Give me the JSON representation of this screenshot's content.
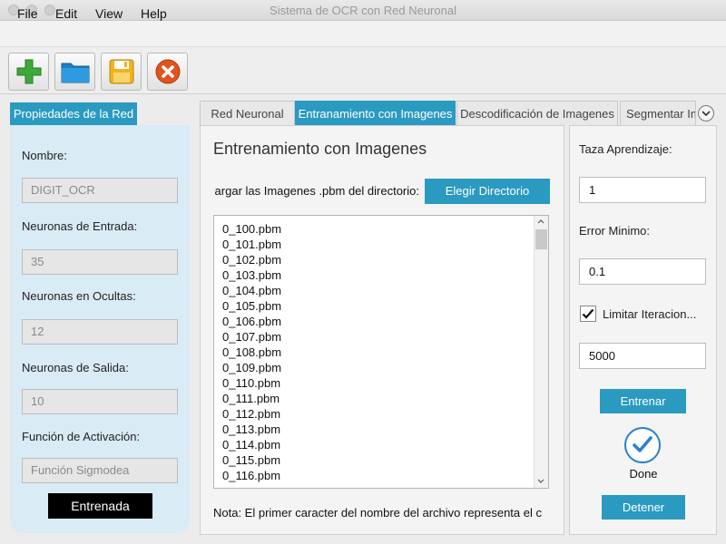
{
  "window": {
    "title": "Sistema de OCR con Red Neuronal"
  },
  "menu": {
    "items": [
      "File",
      "Edit",
      "View",
      "Help"
    ]
  },
  "toolbar": {
    "icons": [
      "add-icon",
      "folder-icon",
      "save-icon",
      "close-icon"
    ]
  },
  "left_panel": {
    "tab": "Propiedades de la Red",
    "fields": [
      {
        "label": "Nombre:",
        "value": "DIGIT_OCR"
      },
      {
        "label": "Neuronas de Entrada:",
        "value": "35"
      },
      {
        "label": "Neuronas en Ocultas:",
        "value": "12"
      },
      {
        "label": "Neuronas de Salida:",
        "value": "10"
      },
      {
        "label": "Función de Activación:",
        "value": "Función Sigmodea"
      }
    ],
    "status": "Entrenada"
  },
  "tabs": [
    "Red Neuronal",
    "Entranamiento con Imagenes",
    "Descodificación de Imagenes",
    "Segmentar Im"
  ],
  "center": {
    "title": "Entrenamiento con Imagenes",
    "dir_label": "argar las Imagenes .pbm del directorio:",
    "choose_button": "Elegir Directorio",
    "files": [
      "0_100.pbm",
      "0_101.pbm",
      "0_102.pbm",
      "0_103.pbm",
      "0_104.pbm",
      "0_105.pbm",
      "0_106.pbm",
      "0_107.pbm",
      "0_108.pbm",
      "0_109.pbm",
      "0_110.pbm",
      "0_111.pbm",
      "0_112.pbm",
      "0_113.pbm",
      "0_114.pbm",
      "0_115.pbm",
      "0_116.pbm"
    ],
    "note": "Nota: El primer caracter del nombre del archivo representa el c"
  },
  "right": {
    "learning_rate_label": "Taza Aprendizaje:",
    "learning_rate": "1",
    "min_error_label": "Error Minimo:",
    "min_error": "0.1",
    "limit_label": "Limitar Iteracion...",
    "limit_checked": true,
    "iterations": "5000",
    "train_button": "Entrenar",
    "done_label": "Done",
    "stop_button": "Detener"
  }
}
